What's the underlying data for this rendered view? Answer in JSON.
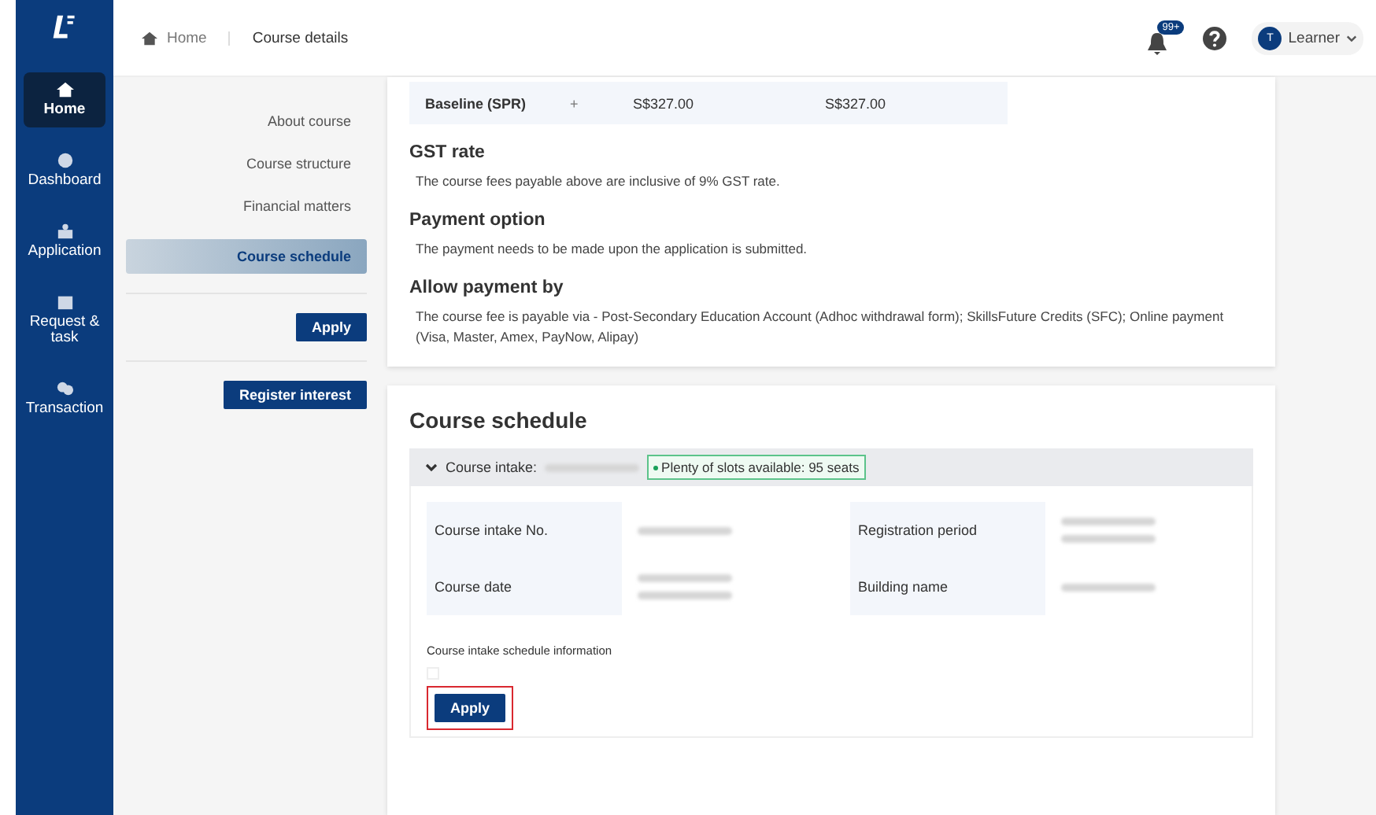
{
  "sidebar": {
    "items": [
      {
        "label": "Home",
        "selected": true
      },
      {
        "label": "Dashboard",
        "selected": false
      },
      {
        "label": "Application",
        "selected": false
      },
      {
        "label": "Request & task",
        "selected": false
      },
      {
        "label": "Transaction",
        "selected": false
      }
    ]
  },
  "breadcrumb": [
    "Home",
    "Course details"
  ],
  "header": {
    "notification_count": "99+",
    "user_initial": "T",
    "user_name": "Learner"
  },
  "course_nav": {
    "items": [
      {
        "label": "About course",
        "selected": false
      },
      {
        "label": "Course structure",
        "selected": false
      },
      {
        "label": "Financial matters",
        "selected": false
      },
      {
        "label": "Course schedule",
        "selected": true
      }
    ],
    "apply_button": "Apply",
    "register_button": "Register interest"
  },
  "fees": {
    "rows": [
      {
        "name": "Baseline (SPR)",
        "toggle": "+",
        "column_2": "S$327.00",
        "column_3": "S$327.00"
      }
    ],
    "sections": [
      {
        "title": "GST rate",
        "text": "The course fees payable above are inclusive of 9% GST rate."
      },
      {
        "title": "Payment option",
        "text": "The payment needs to be made upon the application is submitted."
      },
      {
        "title": "Allow payment by",
        "text": "The course fee is payable via - Post-Secondary Education Account (Adhoc withdrawal form); SkillsFuture Credits (SFC); Online payment (Visa, Master, Amex, PayNow, Alipay)"
      }
    ]
  },
  "schedule": {
    "title": "Course schedule",
    "intake_label": "Course intake:",
    "expanded": true,
    "availability": "Plenty of slots available: 95 seats",
    "fields": [
      {
        "label": "Course intake No."
      },
      {
        "label": "Registration period"
      },
      {
        "label": "Course date"
      },
      {
        "label": "Building name"
      }
    ],
    "info_label": "Course intake schedule information",
    "info_checked": false,
    "apply_button": "Apply"
  }
}
